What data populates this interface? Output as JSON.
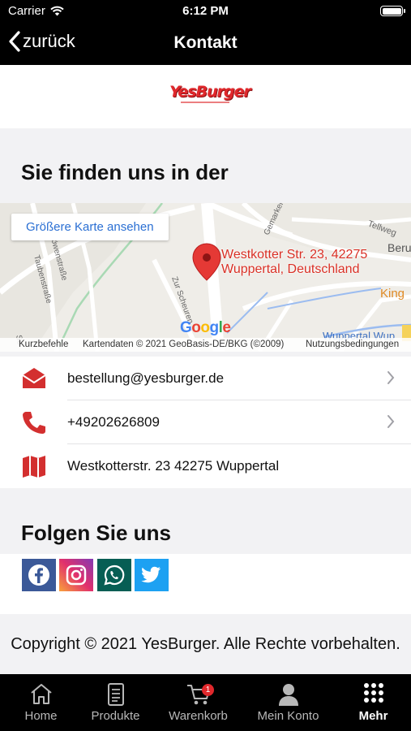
{
  "status_bar": {
    "carrier": "Carrier",
    "time": "6:12 PM"
  },
  "nav": {
    "back_label": "zurück",
    "title": "Kontakt"
  },
  "logo": {
    "text": "YesBurger"
  },
  "find_section": {
    "title": "Sie finden uns in der"
  },
  "map": {
    "larger_map_button": "Größere Karte ansehen",
    "pin_label_line1": "Westkotter Str. 23, 42275",
    "pin_label_line2": "Wuppertal, Deutschland",
    "street_labels": [
      "Gemarkerstr.",
      "Tellweg",
      "Beru",
      "King",
      "Löwenstraße",
      "Taubenstraße",
      "Zur Scheuren",
      "Wuppertal Wup",
      "Se"
    ],
    "google_logo": "Google",
    "footer_shortcuts": "Kurzbefehle",
    "footer_data": "Kartendaten © 2021 GeoBasis-DE/BKG (©2009)",
    "footer_terms": "Nutzungsbedingungen"
  },
  "contacts": [
    {
      "icon": "envelope-icon",
      "text": "bestellung@yesburger.de",
      "has_chevron": true
    },
    {
      "icon": "phone-icon",
      "text": "+49202626809",
      "has_chevron": true
    },
    {
      "icon": "map-icon",
      "text": "Westkotterstr. 23 42275 Wuppertal",
      "has_chevron": false
    }
  ],
  "follow_section": {
    "title": "Folgen Sie uns"
  },
  "social": [
    {
      "name": "facebook-icon",
      "color": "#3b5998"
    },
    {
      "name": "instagram-icon",
      "color": "#c13584"
    },
    {
      "name": "whatsapp-icon",
      "color": "#075e54"
    },
    {
      "name": "twitter-icon",
      "color": "#1da1f2"
    }
  ],
  "footer": {
    "copyright": "Copyright © 2021 YesBurger. Alle Rechte vorbehalten."
  },
  "tabs": [
    {
      "label": "Home",
      "icon": "home-icon",
      "active": false
    },
    {
      "label": "Produkte",
      "icon": "menu-card-icon",
      "active": false
    },
    {
      "label": "Warenkorb",
      "icon": "cart-icon",
      "active": false,
      "badge": "1"
    },
    {
      "label": "Mein Konto",
      "icon": "user-icon",
      "active": false
    },
    {
      "label": "Mehr",
      "icon": "grid-icon",
      "active": true
    }
  ],
  "colors": {
    "brand_red": "#e0282c",
    "link_blue": "#2a6fd3",
    "bar_black": "#000000"
  }
}
